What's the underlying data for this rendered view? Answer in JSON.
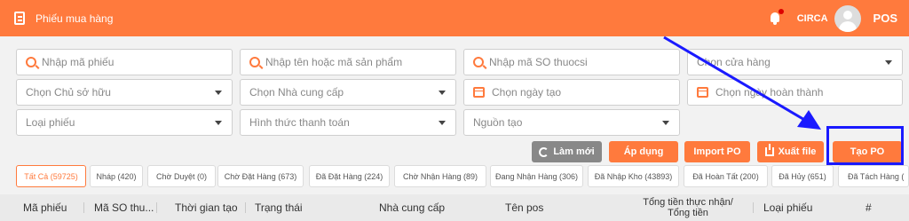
{
  "header": {
    "title": "Phiếu mua hàng",
    "user_name": "CIRCA",
    "pos_label": "POS",
    "bg_color": "#ff7a3d"
  },
  "filters": {
    "row1": [
      {
        "type": "search",
        "placeholder": "Nhập mã phiếu"
      },
      {
        "type": "search",
        "placeholder": "Nhập tên hoặc mã sản phẩm"
      },
      {
        "type": "search",
        "placeholder": "Nhập mã SO thuocsi"
      },
      {
        "type": "select",
        "placeholder": "Chọn cửa hàng"
      }
    ],
    "row2": [
      {
        "type": "select",
        "placeholder": "Chọn Chủ sở hữu"
      },
      {
        "type": "select",
        "placeholder": "Chọn Nhà cung cấp"
      },
      {
        "type": "date",
        "placeholder": "Chọn ngày tạo"
      },
      {
        "type": "date",
        "placeholder": "Chọn ngày hoàn thành"
      }
    ],
    "row3": [
      {
        "type": "select",
        "placeholder": "Loại phiếu"
      },
      {
        "type": "select",
        "placeholder": "Hình thức thanh toán"
      },
      {
        "type": "select",
        "placeholder": "Nguồn tạo"
      }
    ]
  },
  "actions": {
    "refresh": "Làm mới",
    "apply": "Áp dụng",
    "import": "Import PO",
    "export": "Xuất file",
    "create": "Tạo PO"
  },
  "tabs": [
    {
      "label": "Tất Cả (59725)",
      "active": true
    },
    {
      "label": "Nháp (420)"
    },
    {
      "label": "Chờ Duyệt (0)"
    },
    {
      "label": "Chờ Đặt Hàng (673)"
    },
    {
      "label": "Đã Đặt Hàng (224)"
    },
    {
      "label": "Chờ Nhận Hàng (89)"
    },
    {
      "label": "Đang Nhận Hàng (306)"
    },
    {
      "label": "Đã Nhập Kho (43893)"
    },
    {
      "label": "Đã Hoàn Tất (200)"
    },
    {
      "label": "Đã Hủy (651)"
    },
    {
      "label": "Đã Tách Hàng ("
    }
  ],
  "table": {
    "columns": [
      "Mã phiếu",
      "Mã SO thu...",
      "Thời gian tạo",
      "Trạng thái",
      "Nhà cung cấp",
      "Tên pos",
      "Tổng tiền thực nhận/",
      "Tổng tiền",
      "Loại phiếu",
      "#"
    ]
  },
  "colors": {
    "accent": "#ff7a3d",
    "annotation": "#1a1aff",
    "grey_button": "#888888"
  }
}
